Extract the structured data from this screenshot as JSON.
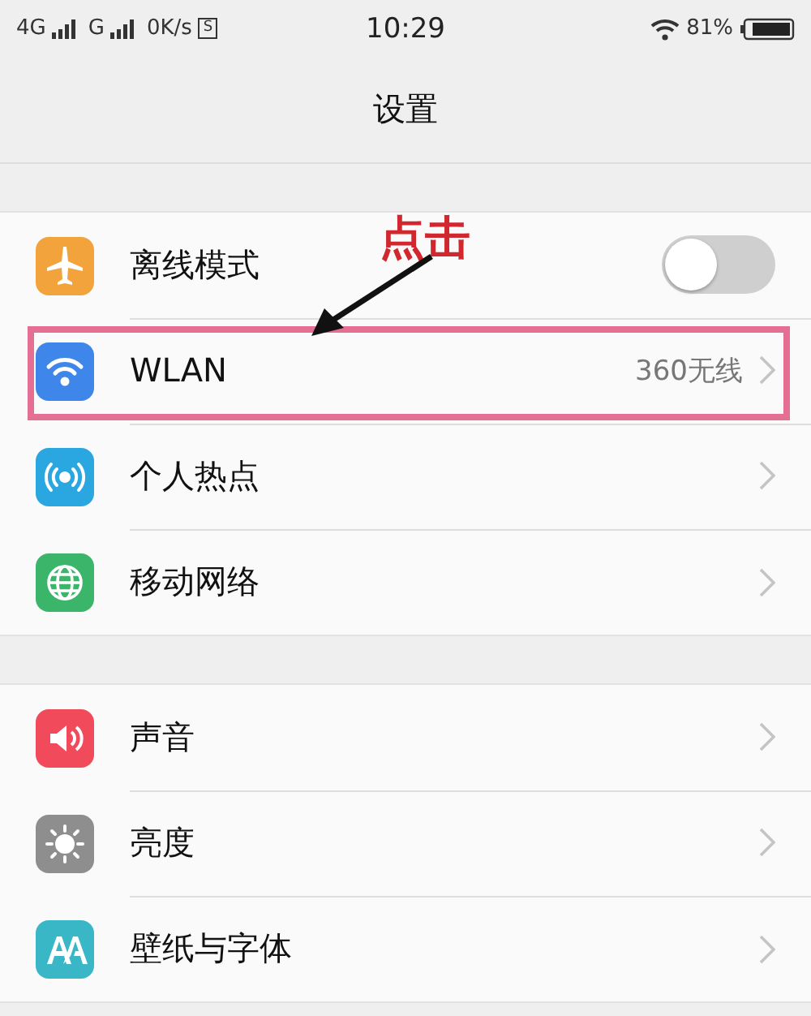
{
  "status_bar": {
    "network_1": "4G",
    "network_2": "G",
    "speed": "0K/s",
    "sim_badge": "S",
    "time": "10:29",
    "battery": "81%"
  },
  "title": "设置",
  "groups": [
    {
      "rows": [
        {
          "label": "离线模式",
          "kind": "toggle",
          "on": false,
          "color": "#f3a33b",
          "highlighted": false
        },
        {
          "label": "WLAN",
          "kind": "link",
          "value": "360无线",
          "color": "#3f86ea",
          "highlighted": true
        },
        {
          "label": "个人热点",
          "kind": "link",
          "color": "#2aa7e0",
          "highlighted": false
        },
        {
          "label": "移动网络",
          "kind": "link",
          "color": "#3bb56a",
          "highlighted": false
        }
      ]
    },
    {
      "rows": [
        {
          "label": "声音",
          "kind": "link",
          "color": "#f04a5b",
          "highlighted": false
        },
        {
          "label": "亮度",
          "kind": "link",
          "color": "#8e8e8e",
          "highlighted": false
        },
        {
          "label": "壁纸与字体",
          "kind": "link",
          "color": "#3ab7c6",
          "highlighted": false
        }
      ]
    }
  ],
  "annotation": {
    "label": "点击"
  }
}
